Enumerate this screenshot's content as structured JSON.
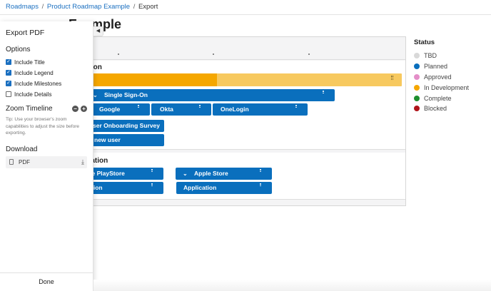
{
  "breadcrumb": {
    "root": "Roadmaps",
    "sep": "/",
    "parent": "Product Roadmap Example",
    "current": "Export"
  },
  "page": {
    "title_visible": "map Example"
  },
  "roadmap": {
    "lanes": [
      {
        "title_visible": "ation",
        "progress_fraction": 0.43
      },
      {
        "title_visible": "ication"
      }
    ],
    "bars": {
      "sso": "Single Sign-On",
      "google": "Google",
      "okta": "Okta",
      "onelogin": "OneLogin",
      "survey": "ser Onboarding Survey",
      "new_user": "new user",
      "playstore": "gle PlayStore",
      "apple_store": "Apple Store",
      "application_left": "tion",
      "application": "Application"
    }
  },
  "legend": {
    "title": "Status",
    "items": [
      {
        "label": "TBD",
        "color": "#d9d9d9"
      },
      {
        "label": "Planned",
        "color": "#0a6fbd"
      },
      {
        "label": "Approved",
        "color": "#e48ec8"
      },
      {
        "label": "In Development",
        "color": "#f5a700"
      },
      {
        "label": "Complete",
        "color": "#1f8f2e"
      },
      {
        "label": "Blocked",
        "color": "#b0141a"
      }
    ]
  },
  "export_panel": {
    "title": "Export PDF",
    "options_heading": "Options",
    "options": [
      {
        "label": "Include Title",
        "checked": true
      },
      {
        "label": "Include Legend",
        "checked": true
      },
      {
        "label": "Include Milestones",
        "checked": true
      },
      {
        "label": "Include Details",
        "checked": false
      }
    ],
    "zoom_heading": "Zoom Timeline",
    "zoom_out": "−",
    "zoom_in": "+",
    "tip": "Tip: Use your browser's zoom capabilities to adjust the size before exporting.",
    "download_heading": "Download",
    "pdf_label": "PDF",
    "done_label": "Done"
  }
}
